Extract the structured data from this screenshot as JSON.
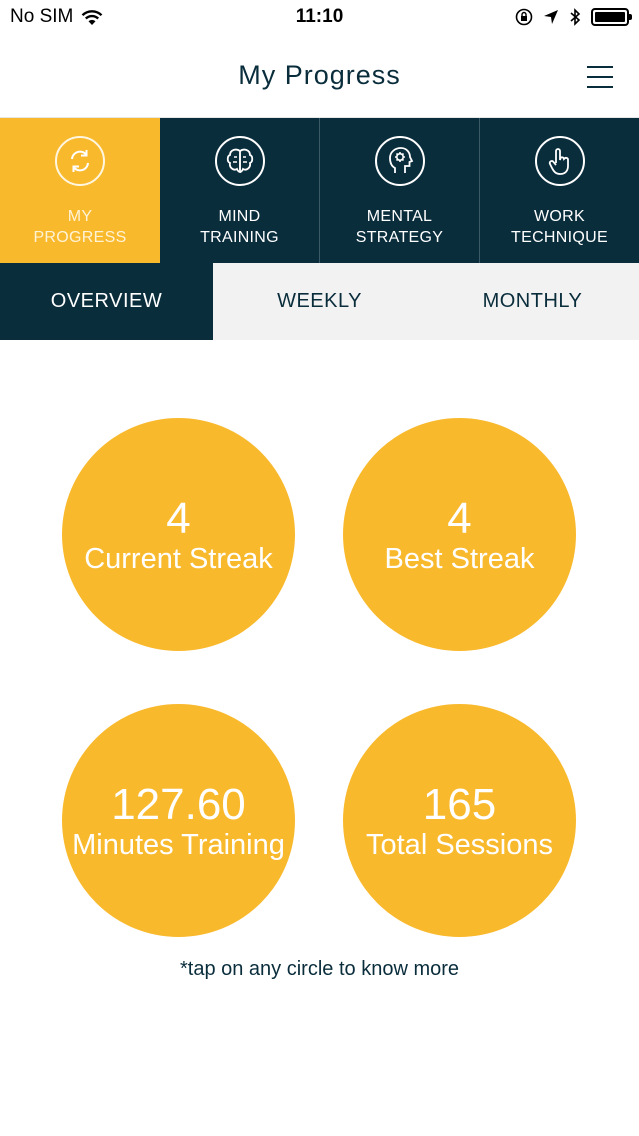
{
  "status_bar": {
    "carrier": "No SIM",
    "time": "11:10"
  },
  "header": {
    "title": "My Progress"
  },
  "category_tabs": [
    {
      "label": "MY\nPROGRESS",
      "icon": "refresh-icon"
    },
    {
      "label": "MIND\nTRAINING",
      "icon": "brain-icon"
    },
    {
      "label": "MENTAL\nSTRATEGY",
      "icon": "head-gear-icon"
    },
    {
      "label": "WORK\nTECHNIQUE",
      "icon": "hand-pointer-icon"
    }
  ],
  "period_tabs": [
    {
      "label": "OVERVIEW"
    },
    {
      "label": "WEEKLY"
    },
    {
      "label": "MONTHLY"
    }
  ],
  "stats": [
    {
      "value": "4",
      "label": "Current Streak"
    },
    {
      "value": "4",
      "label": "Best Streak"
    },
    {
      "value": "127.60",
      "label": "Minutes Training"
    },
    {
      "value": "165",
      "label": "Total Sessions"
    }
  ],
  "hint": "*tap on any circle to know more",
  "colors": {
    "accent": "#f9b92d",
    "navy": "#0a2d3c"
  }
}
